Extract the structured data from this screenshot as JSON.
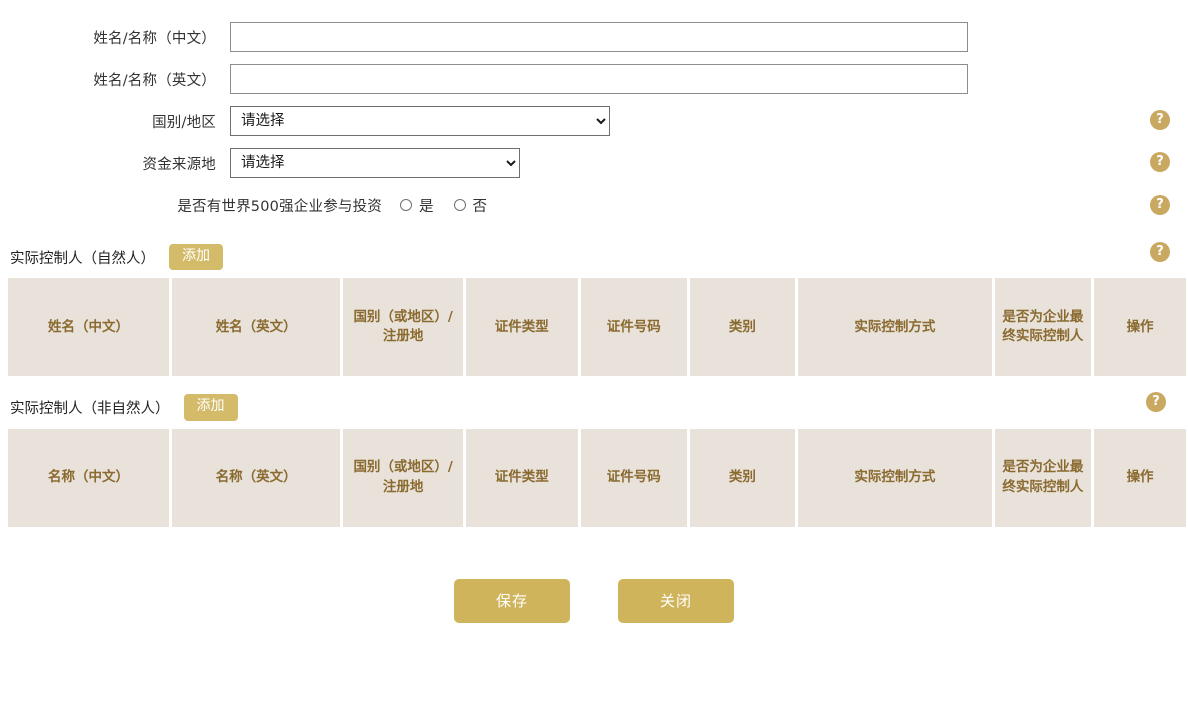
{
  "form": {
    "rows": [
      {
        "label": "姓名/名称（中文）",
        "type": "text",
        "value": "",
        "placeholder": ""
      },
      {
        "label": "姓名/名称（英文）",
        "type": "text",
        "value": "",
        "placeholder": ""
      },
      {
        "label": "国别/地区",
        "type": "select",
        "selected": "请选择",
        "options": [
          "请选择"
        ]
      },
      {
        "label": "资金来源地",
        "type": "select",
        "selected": "请选择",
        "options": [
          "请选择"
        ]
      },
      {
        "label": "是否有世界500强企业参与投资",
        "type": "radio"
      }
    ],
    "radio": {
      "yes_label": "是",
      "no_label": "否",
      "selected": ""
    }
  },
  "help": {
    "glyph": "?",
    "color": "#c9a961"
  },
  "sections": [
    {
      "title": "实际控制人（自然人）",
      "add_label": "添加",
      "columns": [
        "姓名（中文）",
        "姓名（英文）",
        "国别（或地区）/注册地",
        "证件类型",
        "证件号码",
        "类别",
        "实际控制方式",
        "是否为企业最终实际控制人",
        "操作"
      ],
      "rows": []
    },
    {
      "title": "实际控制人（非自然人）",
      "add_label": "添加",
      "columns": [
        "名称（中文）",
        "名称（英文）",
        "国别（或地区）/注册地",
        "证件类型",
        "证件号码",
        "类别",
        "实际控制方式",
        "是否为企业最终实际控制人",
        "操作"
      ],
      "rows": []
    }
  ],
  "footer": {
    "save_label": "保存",
    "close_label": "关闭"
  }
}
